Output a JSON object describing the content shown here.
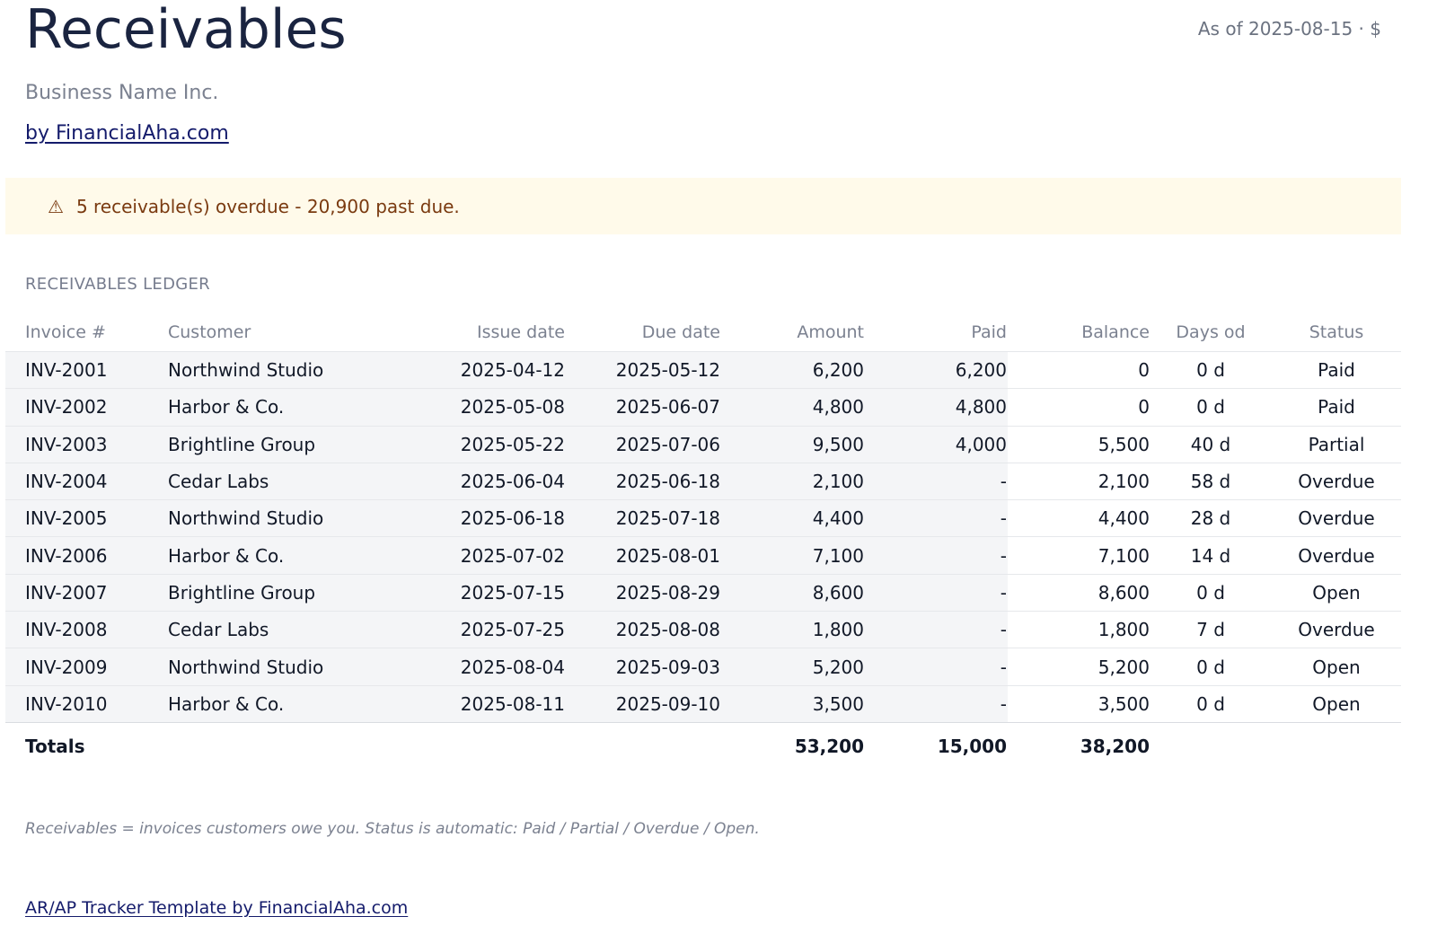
{
  "header": {
    "title": "Receivables",
    "as_of": "As of 2025-08-15 · $",
    "business_name": "Business Name Inc.",
    "brand_link": "by FinancialAha.com"
  },
  "alert": {
    "icon": "⚠",
    "message": "5 receivable(s) overdue - 20,900 past due."
  },
  "ledger": {
    "section_label": "RECEIVABLES LEDGER",
    "columns": [
      "Invoice #",
      "Customer",
      "Issue date",
      "Due date",
      "Amount",
      "Paid",
      "Balance",
      "Days od",
      "Status"
    ],
    "rows": [
      [
        "INV-2001",
        "Northwind Studio",
        "2025-04-12",
        "2025-05-12",
        "6,200",
        "6,200",
        "0",
        "0 d",
        "Paid"
      ],
      [
        "INV-2002",
        "Harbor & Co.",
        "2025-05-08",
        "2025-06-07",
        "4,800",
        "4,800",
        "0",
        "0 d",
        "Paid"
      ],
      [
        "INV-2003",
        "Brightline Group",
        "2025-05-22",
        "2025-07-06",
        "9,500",
        "4,000",
        "5,500",
        "40 d",
        "Partial"
      ],
      [
        "INV-2004",
        "Cedar Labs",
        "2025-06-04",
        "2025-06-18",
        "2,100",
        "-",
        "2,100",
        "58 d",
        "Overdue"
      ],
      [
        "INV-2005",
        "Northwind Studio",
        "2025-06-18",
        "2025-07-18",
        "4,400",
        "-",
        "4,400",
        "28 d",
        "Overdue"
      ],
      [
        "INV-2006",
        "Harbor & Co.",
        "2025-07-02",
        "2025-08-01",
        "7,100",
        "-",
        "7,100",
        "14 d",
        "Overdue"
      ],
      [
        "INV-2007",
        "Brightline Group",
        "2025-07-15",
        "2025-08-29",
        "8,600",
        "-",
        "8,600",
        "0 d",
        "Open"
      ],
      [
        "INV-2008",
        "Cedar Labs",
        "2025-07-25",
        "2025-08-08",
        "1,800",
        "-",
        "1,800",
        "7 d",
        "Overdue"
      ],
      [
        "INV-2009",
        "Northwind Studio",
        "2025-08-04",
        "2025-09-03",
        "5,200",
        "-",
        "5,200",
        "0 d",
        "Open"
      ],
      [
        "INV-2010",
        "Harbor & Co.",
        "2025-08-11",
        "2025-09-10",
        "3,500",
        "-",
        "3,500",
        "0 d",
        "Open"
      ]
    ],
    "totals": {
      "label": "Totals",
      "amount": "53,200",
      "paid": "15,000",
      "balance": "38,200"
    }
  },
  "footnote": "Receivables = invoices customers owe you. Status is automatic: Paid / Partial / Overdue / Open.",
  "footer_link": "AR/AP Tracker Template by FinancialAha.com"
}
